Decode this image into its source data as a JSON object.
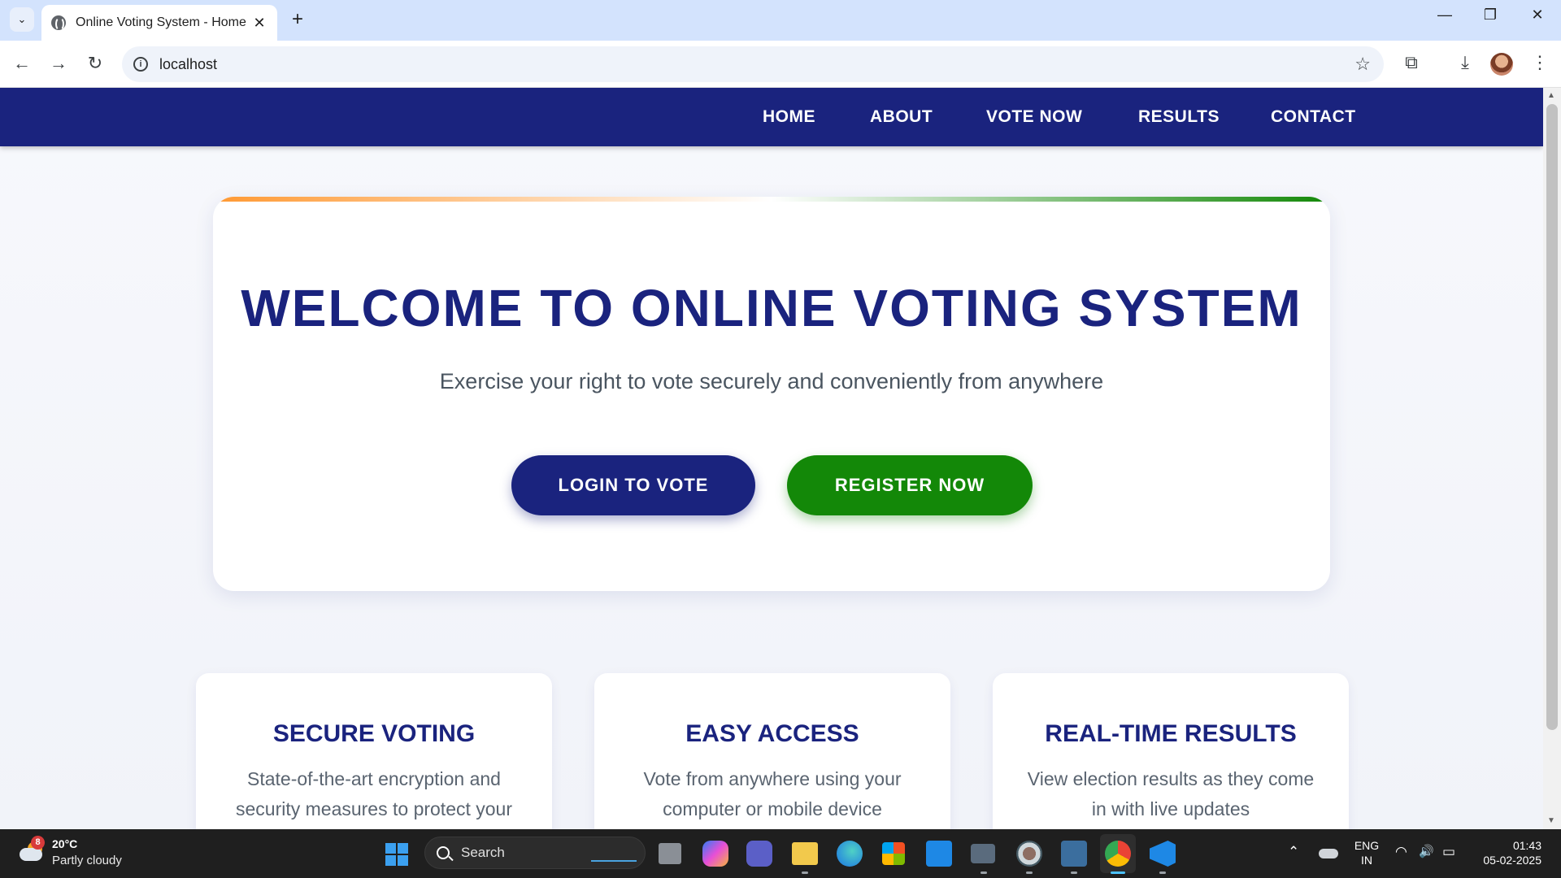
{
  "browser": {
    "tab_title": "Online Voting System - Home",
    "tab_close": "✕",
    "new_tab": "+",
    "tab_list": "⌄",
    "url": "localhost",
    "window_minimize": "—",
    "window_restore": "❐",
    "window_close": "✕",
    "back": "←",
    "forward": "→",
    "reload": "↻",
    "info_glyph": "i",
    "star": "☆",
    "extensions": "⧉",
    "downloads": "⤓",
    "menu": "⋮"
  },
  "site": {
    "nav": [
      "HOME",
      "ABOUT",
      "VOTE NOW",
      "RESULTS",
      "CONTACT"
    ],
    "hero": {
      "title": "WELCOME TO ONLINE VOTING SYSTEM",
      "subtitle": "Exercise your right to vote securely and conveniently from anywhere",
      "login_button": "LOGIN TO VOTE",
      "register_button": "REGISTER NOW"
    },
    "features": [
      {
        "title": "SECURE VOTING",
        "desc": "State-of-the-art encryption and security measures to protect your"
      },
      {
        "title": "EASY ACCESS",
        "desc": "Vote from anywhere using your computer or mobile device"
      },
      {
        "title": "REAL-TIME RESULTS",
        "desc": "View election results as they come in with live updates"
      }
    ],
    "colors": {
      "primary": "#1a237e",
      "secondary": "#138808",
      "saffron": "#ff9933"
    }
  },
  "taskbar": {
    "weather_badge": "8",
    "temperature": "20°C",
    "condition": "Partly cloudy",
    "search_label": "Search",
    "tray_up": "⌃",
    "lang_1": "ENG",
    "lang_2": "IN",
    "wifi": "◠",
    "volume": "🔊",
    "battery": "▭",
    "time": "01:43",
    "date": "05-02-2025"
  }
}
